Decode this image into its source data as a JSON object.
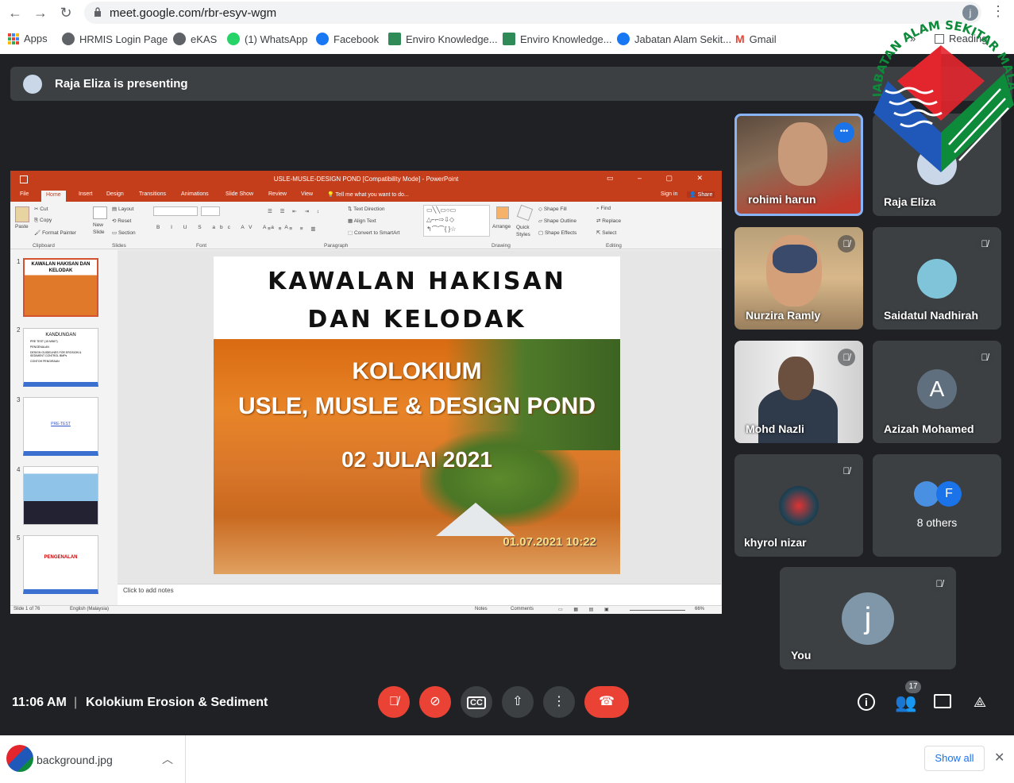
{
  "browser": {
    "url": "meet.google.com/rbr-esyv-wgm",
    "bookmarks": [
      "Apps",
      "HRMIS Login Page",
      "eKAS",
      "(1) WhatsApp",
      "Facebook",
      "Enviro Knowledge...",
      "Enviro Knowledge...",
      "Jabatan Alam Sekit...",
      "Gmail"
    ],
    "overflow": "»",
    "reading": "Reading",
    "profile_initial": "j"
  },
  "logo": {
    "text": "JABATAN ALAM SEKITAR MALAYSIA"
  },
  "meet": {
    "presenting": "Raja Eliza is presenting",
    "time": "11:06 AM",
    "separator": "|",
    "meeting_title": "Kolokium Erosion & Sediment",
    "people_count": "17",
    "participants": [
      {
        "name": "rohimi harun",
        "more": "•••"
      },
      {
        "name": "Raja Eliza"
      },
      {
        "name": "Nurzira Ramly"
      },
      {
        "name": "Saidatul Nadhirah"
      },
      {
        "name": "Mohd Nazli"
      },
      {
        "name": "Azizah Mohamed",
        "initial": "A"
      },
      {
        "name": "khyrol nizar"
      },
      {
        "name": "8 others",
        "initial": "F"
      },
      {
        "name": "You",
        "initial": "j"
      }
    ]
  },
  "ppt": {
    "title": "USLE-MUSLE-DESIGN POND [Compatibility Mode] - PowerPoint",
    "tabs": [
      "File",
      "Home",
      "Insert",
      "Design",
      "Transitions",
      "Animations",
      "Slide Show",
      "Review",
      "View",
      "Tell me what you want to do..."
    ],
    "signin": "Sign in",
    "share": "Share",
    "groups": [
      "Clipboard",
      "Slides",
      "Font",
      "Paragraph",
      "Drawing",
      "Editing"
    ],
    "ribbon": {
      "paste": "Paste",
      "cut": "Cut",
      "copy": "Copy",
      "format_painter": "Format Painter",
      "new_slide": "New Slide",
      "layout": "Layout",
      "reset": "Reset",
      "section": "Section",
      "text_direction": "Text Direction",
      "align_text": "Align Text",
      "smartart": "Convert to SmartArt",
      "arrange": "Arrange",
      "quick_styles": "Quick Styles",
      "shape_fill": "Shape Fill",
      "shape_outline": "Shape Outline",
      "shape_effects": "Shape Effects",
      "find": "Find",
      "replace": "Replace",
      "select": "Select"
    },
    "thumbs": [
      {
        "num": "1",
        "title": "KAWALAN HAKISAN DAN KELODAK"
      },
      {
        "num": "2",
        "title": "KANDUNGAN",
        "bullets": [
          "PRE TEST (15 MINIT)",
          "PENGENALAN",
          "DESIGN GUIDELINES FOR EROSION & SEDIMENT CONTROL BMPs",
          "CONTOH PENGIRAAN"
        ]
      },
      {
        "num": "3",
        "title": "PRE-TEST"
      },
      {
        "num": "4",
        "title": ""
      },
      {
        "num": "5",
        "title": "PENGENALAN"
      }
    ],
    "slide": {
      "line1": "KAWALAN HAKISAN",
      "line2": "DAN KELODAK",
      "sub1": "KOLOKIUM",
      "sub2": "USLE, MUSLE & DESIGN POND",
      "date": "02 JULAI 2021",
      "stamp": "01.07.2021 10:22"
    },
    "notes": "Click to add notes",
    "status_left": "Slide 1 of 76",
    "language": "English (Malaysia)",
    "notes_btn": "Notes",
    "comments_btn": "Comments",
    "zoom": "66%"
  },
  "download": {
    "file": "background.jpg",
    "show_all": "Show all"
  }
}
